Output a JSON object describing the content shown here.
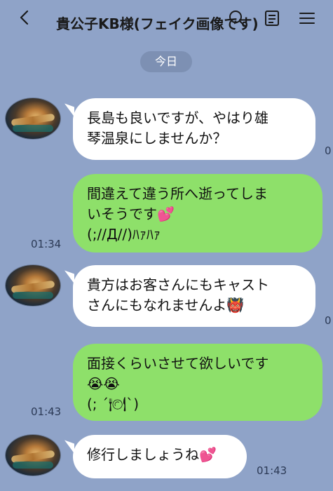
{
  "header": {
    "title": "貴公子KB様(フェイク画像です)",
    "back_icon": "chevron-left-icon",
    "icons": [
      "search-icon",
      "note-icon",
      "menu-icon"
    ]
  },
  "date_divider": "今日",
  "messages": [
    {
      "side": "left",
      "text_lines": [
        "長島も良いですが、やはり雄",
        "琴温泉にしませんか？"
      ],
      "time": "0"
    },
    {
      "side": "right",
      "text_lines": [
        "間違えて違う所へ逝ってしま",
        "いそうです💕",
        "(;//Д//)ﾊｧﾊｧ"
      ],
      "time": "01:34"
    },
    {
      "side": "left",
      "text_lines": [
        "貴方はお客さんにもキャスト",
        "さんにもなれませんよ👹"
      ],
      "time": "0"
    },
    {
      "side": "right",
      "text_lines": [
        "面接くらいさせて欲しいです",
        "😭😭",
        "(; ´🍽`)"
      ],
      "time": "01:43"
    },
    {
      "side": "left",
      "text_lines": [
        "修行しましょうね💕"
      ],
      "time": "01:43"
    }
  ],
  "colors": {
    "background": "#8fa3c8",
    "bubble_white": "#ffffff",
    "bubble_green": "#8ee06a"
  }
}
